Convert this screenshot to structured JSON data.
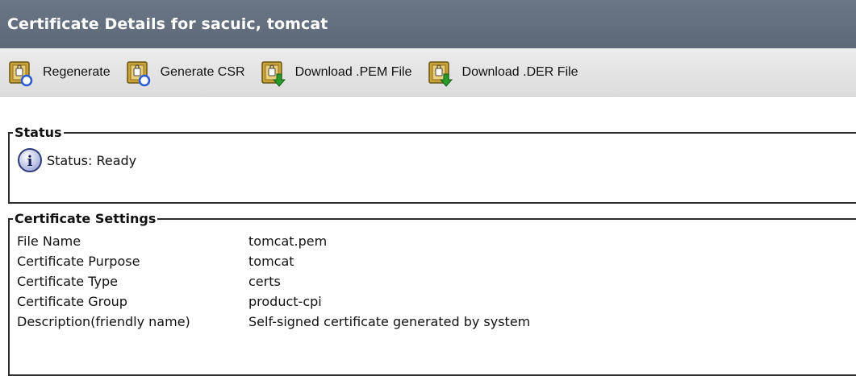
{
  "header": {
    "title": "Certificate Details for sacuic, tomcat"
  },
  "toolbar": {
    "buttons": [
      {
        "label": "Regenerate",
        "icon": "certificate-regenerate-icon"
      },
      {
        "label": "Generate CSR",
        "icon": "certificate-regenerate-icon"
      },
      {
        "label": "Download .PEM File",
        "icon": "certificate-download-icon"
      },
      {
        "label": "Download .DER File",
        "icon": "certificate-download-icon"
      }
    ]
  },
  "status": {
    "legend": "Status",
    "icon": "info-icon",
    "text": "Status: Ready"
  },
  "settings": {
    "legend": "Certificate Settings",
    "rows": [
      {
        "label": "File Name",
        "value": "tomcat.pem"
      },
      {
        "label": "Certificate Purpose",
        "value": "tomcat"
      },
      {
        "label": "Certificate Type",
        "value": "certs"
      },
      {
        "label": "Certificate Group",
        "value": "product-cpi"
      },
      {
        "label": "Description(friendly name)",
        "value": "Self-signed certificate generated by system"
      }
    ]
  },
  "colors": {
    "titlebar": "#5d6978",
    "toolbar": "#e2e2e2",
    "icon_gold": "#c9a23a",
    "icon_blue": "#2a5bd1",
    "icon_green": "#2a9a2a"
  }
}
